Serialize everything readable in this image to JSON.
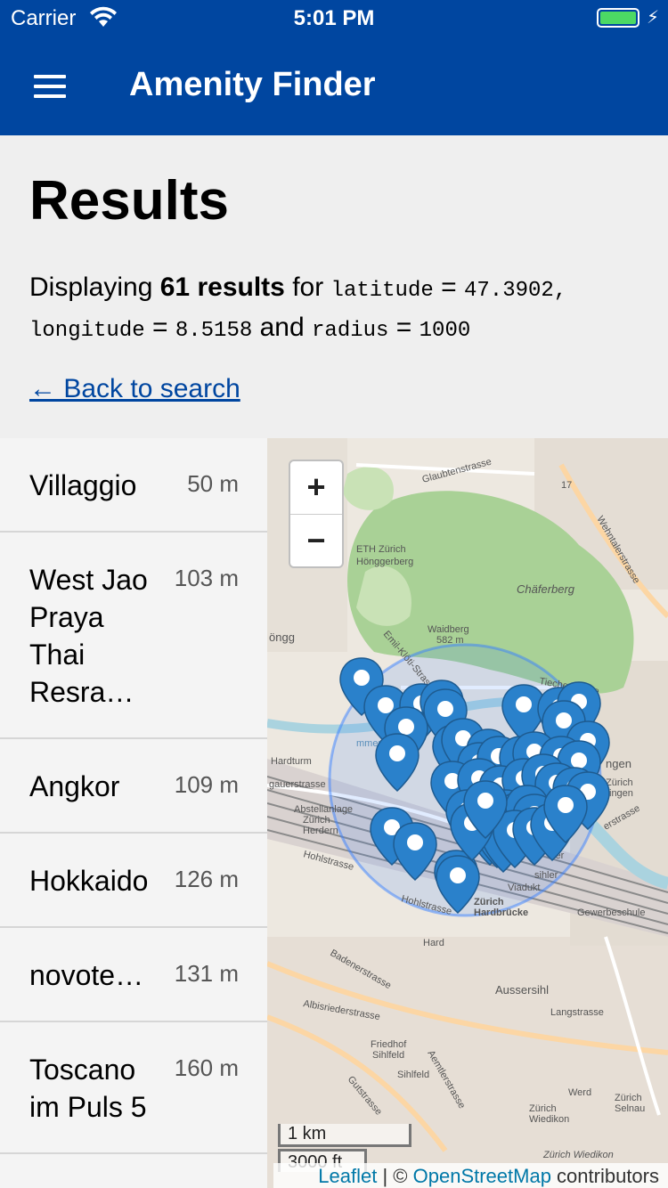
{
  "status_bar": {
    "carrier": "Carrier",
    "time": "5:01 PM"
  },
  "app_bar": {
    "title": "Amenity Finder"
  },
  "page": {
    "title": "Results",
    "summary": {
      "prefix": "Displaying",
      "count_text": "61 results",
      "for_text": "for",
      "lat_label": "latitude",
      "eq": "=",
      "lat_value": "47.3902",
      "comma": ",",
      "lon_label": "longitude",
      "lon_value": "8.5158",
      "and_text": "and",
      "radius_label": "radius",
      "radius_value": "1000"
    },
    "back_link": "← Back to search"
  },
  "results": [
    {
      "name": "Villaggio",
      "distance": "50 m"
    },
    {
      "name": "West Jao Praya Thai Resra…",
      "distance": "103 m"
    },
    {
      "name": "Angkor",
      "distance": "109 m"
    },
    {
      "name": "Hokkaido",
      "distance": "126 m"
    },
    {
      "name": "novote…",
      "distance": "131 m"
    },
    {
      "name": "Toscano im Puls 5",
      "distance": "160 m"
    }
  ],
  "map": {
    "zoom_in": "+",
    "zoom_out": "−",
    "scale_metric": "1 km",
    "scale_imperial": "3000 ft",
    "attribution_leaflet": "Leaflet",
    "attribution_sep": " | © ",
    "attribution_osm": "OpenStreetMap",
    "attribution_suffix": " contributors",
    "labels": {
      "glaubtenstrasse": "Glaubtenstrasse",
      "eth": "ETH Zürich",
      "honggerberg": "Hönggerberg",
      "chaferberg": "Chäferberg",
      "waidberg": "Waidberg",
      "waidberg_elev": "582 m",
      "emil": "Emil-Klöti-Strasse",
      "tiechestrasse": "Tiechestrasse",
      "hongg": "öngg",
      "hardturm": "Hardturm",
      "gauerstrasse": "gauerstrasse",
      "abstellanlage": "Abstellanlage",
      "zurich": "Zürich",
      "herdern": "Herdern",
      "hohlstrasse": "Hohlstrasse",
      "hohlstrasse2": "Hohlstrasse",
      "hardbrucke": "Hardbrücke",
      "zurich2": "Zürich",
      "hard": "Hard",
      "viadukt": "Viadukt",
      "gewerbeschule": "Gewerbeschule",
      "badener": "Badenerstrasse",
      "aussersihl": "Aussersihl",
      "langstrasse": "Langstrasse",
      "albisrieder": "Albisriederstrasse",
      "friedhof": "Friedhof",
      "sihlfeld": "Sihlfeld",
      "sihlfeld2": "Sihlfeld",
      "aemtler": "Aemtlerstrasse",
      "gutstrasse": "Gutstrasse",
      "werd": "Werd",
      "zurich_wiedikon": "Zürich",
      "wiedikon": "Wiedikon",
      "zurich_selnau": "Zürich",
      "selnau": "Selnau",
      "zurich_wiedikon2": "Zürich Wiedikon",
      "route17": "17",
      "wehntaler": "Wehntalerstrasse",
      "ngen": "ngen",
      "zurich_oerlikon": "Zürich",
      "ingen": "ingen",
      "ersstrasse": "erstrasse",
      "tier": "tier",
      "sihler": "sihler",
      "immer": "mmer"
    }
  }
}
